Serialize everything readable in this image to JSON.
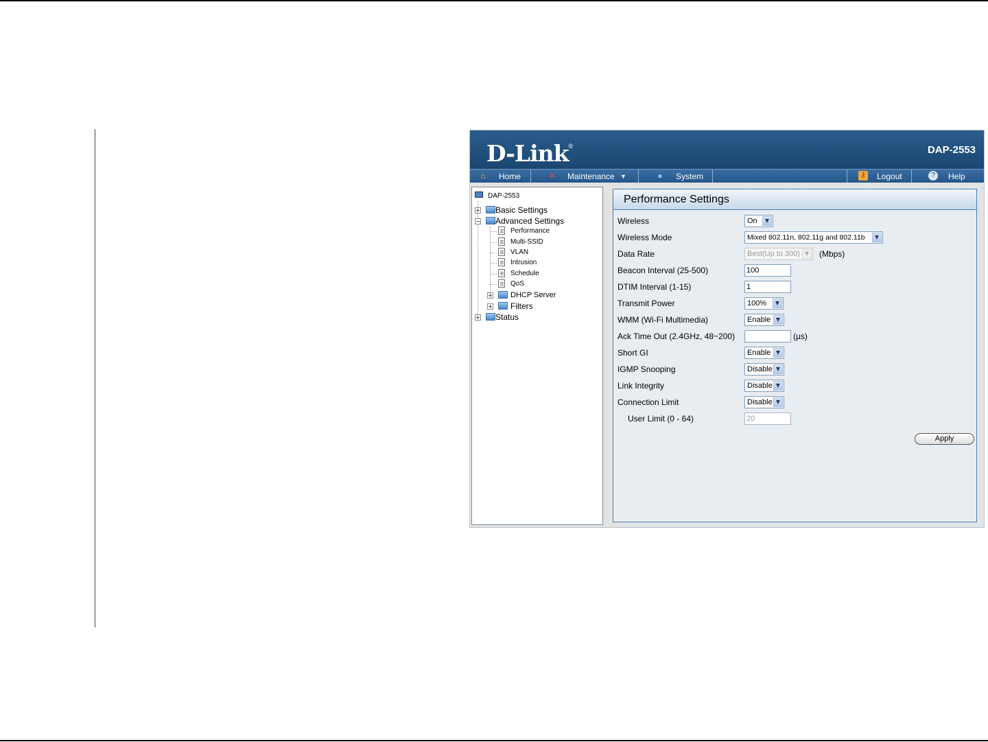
{
  "header": {
    "logo": "D-Link",
    "logo_mark": "®",
    "model": "DAP-2553"
  },
  "nav": {
    "home": "Home",
    "maintenance": "Maintenance",
    "system": "System",
    "logout": "Logout",
    "help": "Help"
  },
  "tree": {
    "root": "DAP-2553",
    "basic_settings": "Basic Settings",
    "advanced_settings": "Advanced Settings",
    "performance": "Performance",
    "multi_ssid": "Multi-SSID",
    "vlan": "VLAN",
    "intrusion": "Intrusion",
    "schedule": "Schedule",
    "qos": "QoS",
    "dhcp_server": "DHCP Server",
    "filters": "Filters",
    "status": "Status"
  },
  "panel": {
    "title": "Performance Settings",
    "wireless": {
      "label": "Wireless",
      "value": "On"
    },
    "wireless_mode": {
      "label": "Wireless Mode",
      "value": "Mixed 802.11n, 802.11g and 802.11b"
    },
    "data_rate": {
      "label": "Data Rate",
      "value": "Best(Up to 300)",
      "unit": "(Mbps)"
    },
    "beacon_interval": {
      "label": "Beacon Interval (25-500)",
      "value": "100"
    },
    "dtim_interval": {
      "label": "DTIM Interval (1-15)",
      "value": "1"
    },
    "transmit_power": {
      "label": "Transmit Power",
      "value": "100%"
    },
    "wmm": {
      "label": "WMM (Wi-Fi Multimedia)",
      "value": "Enable"
    },
    "ack_timeout": {
      "label": "Ack Time Out (2.4GHz, 48~200)",
      "value": "",
      "unit": "(µs)"
    },
    "short_gi": {
      "label": "Short GI",
      "value": "Enable"
    },
    "igmp_snooping": {
      "label": "IGMP Snooping",
      "value": "Disable"
    },
    "link_integrity": {
      "label": "Link Integrity",
      "value": "Disable"
    },
    "connection_limit": {
      "label": "Connection Limit",
      "value": "Disable"
    },
    "user_limit": {
      "label": "User Limit (0 - 64)",
      "value": "20"
    },
    "apply": "Apply"
  },
  "colors": {
    "banner": "#1c4671",
    "navbar": "#24568a",
    "panel_bg": "#e8edf1"
  },
  "icons": [
    "home-icon",
    "tools-icon",
    "globe-icon",
    "key-icon",
    "help-icon",
    "folder-icon",
    "document-icon",
    "computer-icon"
  ]
}
